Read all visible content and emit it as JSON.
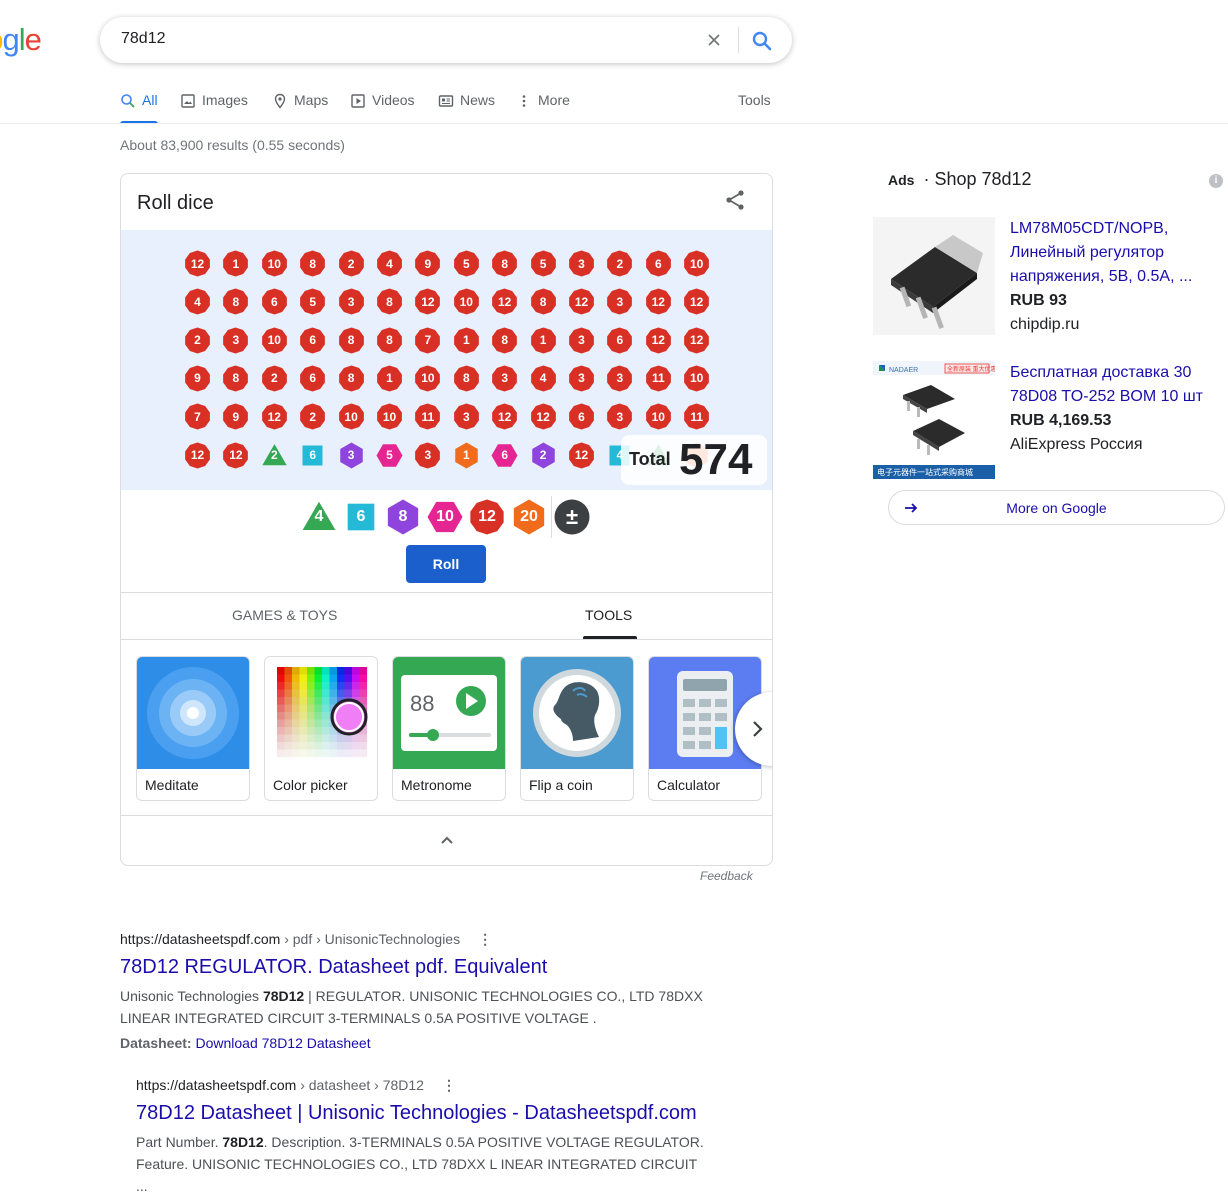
{
  "logo_text": "oogle",
  "search": {
    "query": "78d12"
  },
  "tabs": [
    {
      "label": "All",
      "icon": "search-icon"
    },
    {
      "label": "Images",
      "icon": "image-icon"
    },
    {
      "label": "Maps",
      "icon": "map-pin-icon"
    },
    {
      "label": "Videos",
      "icon": "play-icon"
    },
    {
      "label": "News",
      "icon": "news-icon"
    },
    {
      "label": "More",
      "icon": "kebab-icon"
    }
  ],
  "tools_label": "Tools",
  "stats": "About 83,900 results (0.55 seconds)",
  "dice": {
    "title": "Roll dice",
    "total_label": "Total",
    "total_value": "574",
    "rows": [
      [
        {
          "v": "12",
          "s": "d12"
        },
        {
          "v": "1",
          "s": "d12"
        },
        {
          "v": "10",
          "s": "d12"
        },
        {
          "v": "8",
          "s": "d12"
        },
        {
          "v": "2",
          "s": "d12"
        },
        {
          "v": "4",
          "s": "d12"
        },
        {
          "v": "9",
          "s": "d12"
        },
        {
          "v": "5",
          "s": "d12"
        },
        {
          "v": "8",
          "s": "d12"
        },
        {
          "v": "5",
          "s": "d12"
        },
        {
          "v": "3",
          "s": "d12"
        },
        {
          "v": "2",
          "s": "d12"
        },
        {
          "v": "6",
          "s": "d12"
        },
        {
          "v": "10",
          "s": "d12"
        }
      ],
      [
        {
          "v": "4",
          "s": "d12"
        },
        {
          "v": "8",
          "s": "d12"
        },
        {
          "v": "6",
          "s": "d12"
        },
        {
          "v": "5",
          "s": "d12"
        },
        {
          "v": "3",
          "s": "d12"
        },
        {
          "v": "8",
          "s": "d12"
        },
        {
          "v": "12",
          "s": "d12"
        },
        {
          "v": "10",
          "s": "d12"
        },
        {
          "v": "12",
          "s": "d12"
        },
        {
          "v": "8",
          "s": "d12"
        },
        {
          "v": "12",
          "s": "d12"
        },
        {
          "v": "3",
          "s": "d12"
        },
        {
          "v": "12",
          "s": "d12"
        },
        {
          "v": "12",
          "s": "d12"
        }
      ],
      [
        {
          "v": "2",
          "s": "d12"
        },
        {
          "v": "3",
          "s": "d12"
        },
        {
          "v": "10",
          "s": "d12"
        },
        {
          "v": "6",
          "s": "d12"
        },
        {
          "v": "8",
          "s": "d12"
        },
        {
          "v": "8",
          "s": "d12"
        },
        {
          "v": "7",
          "s": "d12"
        },
        {
          "v": "1",
          "s": "d12"
        },
        {
          "v": "8",
          "s": "d12"
        },
        {
          "v": "1",
          "s": "d12"
        },
        {
          "v": "3",
          "s": "d12"
        },
        {
          "v": "6",
          "s": "d12"
        },
        {
          "v": "12",
          "s": "d12"
        },
        {
          "v": "12",
          "s": "d12"
        }
      ],
      [
        {
          "v": "9",
          "s": "d12"
        },
        {
          "v": "8",
          "s": "d12"
        },
        {
          "v": "2",
          "s": "d12"
        },
        {
          "v": "6",
          "s": "d12"
        },
        {
          "v": "8",
          "s": "d12"
        },
        {
          "v": "1",
          "s": "d12"
        },
        {
          "v": "10",
          "s": "d12"
        },
        {
          "v": "8",
          "s": "d12"
        },
        {
          "v": "3",
          "s": "d12"
        },
        {
          "v": "4",
          "s": "d12"
        },
        {
          "v": "3",
          "s": "d12"
        },
        {
          "v": "3",
          "s": "d12"
        },
        {
          "v": "11",
          "s": "d12"
        },
        {
          "v": "10",
          "s": "d12"
        }
      ],
      [
        {
          "v": "7",
          "s": "d12"
        },
        {
          "v": "9",
          "s": "d12"
        },
        {
          "v": "12",
          "s": "d12"
        },
        {
          "v": "2",
          "s": "d12"
        },
        {
          "v": "10",
          "s": "d12"
        },
        {
          "v": "10",
          "s": "d12"
        },
        {
          "v": "11",
          "s": "d12"
        },
        {
          "v": "3",
          "s": "d12"
        },
        {
          "v": "12",
          "s": "d12"
        },
        {
          "v": "12",
          "s": "d12"
        },
        {
          "v": "6",
          "s": "d12"
        },
        {
          "v": "3",
          "s": "d12"
        },
        {
          "v": "10",
          "s": "d12"
        },
        {
          "v": "11",
          "s": "d12"
        }
      ],
      [
        {
          "v": "12",
          "s": "d12"
        },
        {
          "v": "12",
          "s": "d12"
        },
        {
          "v": "2",
          "s": "d4"
        },
        {
          "v": "6",
          "s": "d6"
        },
        {
          "v": "3",
          "s": "d8"
        },
        {
          "v": "5",
          "s": "d10"
        },
        {
          "v": "3",
          "s": "d12"
        },
        {
          "v": "1",
          "s": "d20"
        },
        {
          "v": "6",
          "s": "d10"
        },
        {
          "v": "2",
          "s": "d8"
        },
        {
          "v": "12",
          "s": "d12"
        },
        {
          "v": "4",
          "s": "d6"
        },
        {
          "v": "",
          "s": "d4"
        },
        {
          "v": "",
          "s": "d20"
        }
      ]
    ],
    "pickers": [
      {
        "v": "4",
        "s": "d4"
      },
      {
        "v": "6",
        "s": "d6"
      },
      {
        "v": "8",
        "s": "d8"
      },
      {
        "v": "10",
        "s": "d10"
      },
      {
        "v": "12",
        "s": "d12"
      },
      {
        "v": "20",
        "s": "d20"
      },
      {
        "v": "±",
        "s": "pm"
      }
    ],
    "roll_label": "Roll",
    "colors": {
      "d4": "#34a853",
      "d6": "#24b9d7",
      "d8": "#8e44dd",
      "d10": "#e52592",
      "d12": "#d93025",
      "d20": "#f06c1c",
      "pm": "#3c4043"
    }
  },
  "tool_tabs": [
    "GAMES & TOYS",
    "TOOLS"
  ],
  "tiles": [
    "Meditate",
    "Color picker",
    "Metronome",
    "Flip a coin",
    "Calculator"
  ],
  "metronome_bpm": "88",
  "feedback": "Feedback",
  "results": [
    {
      "domain": "https://datasheetspdf.com",
      "path": " › pdf › UnisonicTechnologies",
      "title": "78D12 REGULATOR. Datasheet pdf. Equivalent",
      "snippet_a": "Unisonic Technologies ",
      "snippet_b": "78D12",
      "snippet_c": " | REGULATOR. UNISONIC TECHNOLOGIES CO., LTD 78DXX LINEAR INTEGRATED CIRCUIT 3-TERMINALS 0.5A POSITIVE VOLTAGE .",
      "extra_label": "Datasheet: ",
      "extra_link": "Download 78D12 Datasheet"
    },
    {
      "domain": "https://datasheetspdf.com",
      "path": " › datasheet › 78D12",
      "title": "78D12 Datasheet | Unisonic Technologies - Datasheetspdf.com",
      "snippet_a": "Part Number. ",
      "snippet_b": "78D12",
      "snippet_c": ". Description. 3-TERMINALS 0.5A POSITIVE VOLTAGE REGULATOR. Feature. UNISONIC TECHNOLOGIES CO., LTD 78DXX L INEAR INTEGRATED CIRCUIT ..."
    }
  ],
  "ads": {
    "label": "Ads",
    "heading": " · Shop 78d12",
    "items": [
      {
        "title": "LM78M05CDT/NOPB, Линейный регулятор напряжения, 5В, 0.5А, ...",
        "price": "RUB 93",
        "merchant": "chipdip.ru"
      },
      {
        "title": "Бесплатная доставка 30 78D08 TO-252 BOM 10 шт",
        "price": "RUB 4,169.53",
        "merchant": "AliExpress Россия"
      }
    ],
    "thumb_texts": [
      "NADAER",
      "全新原装 重大优惠",
      "电子元器件一站式采购商城"
    ],
    "more_label": "More on Google"
  }
}
